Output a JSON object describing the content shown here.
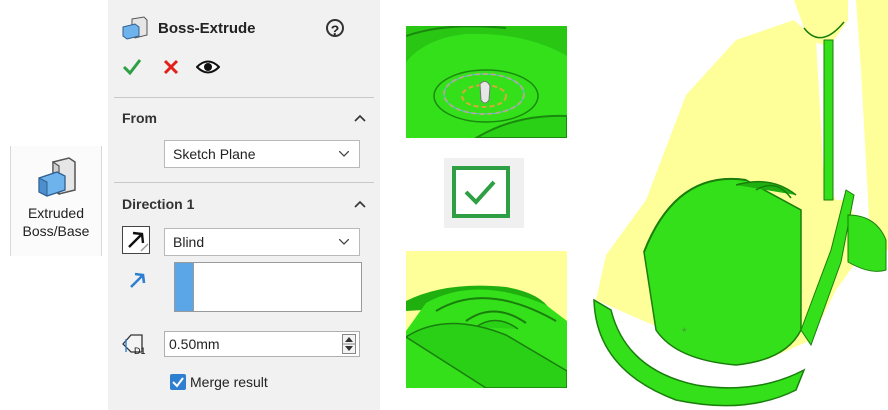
{
  "command": {
    "label_line1": "Extruded",
    "label_line2": "Boss/Base",
    "icon": "extrude-boss-icon"
  },
  "panel": {
    "title": "Boss-Extrude",
    "help_icon": "help-icon",
    "actions": {
      "ok": "check-icon",
      "cancel": "close-icon",
      "preview": "eye-icon"
    },
    "from": {
      "heading": "From",
      "value": "Sketch Plane"
    },
    "direction1": {
      "heading": "Direction 1",
      "end_condition": "Blind",
      "depth": "0.50mm",
      "merge_result_label": "Merge result",
      "merge_result_checked": true
    }
  },
  "colors": {
    "part_green": "#33e01a",
    "section_yellow": "#ffff99",
    "confirm_green": "#2ea043",
    "accent_blue": "#2f7fd1"
  }
}
